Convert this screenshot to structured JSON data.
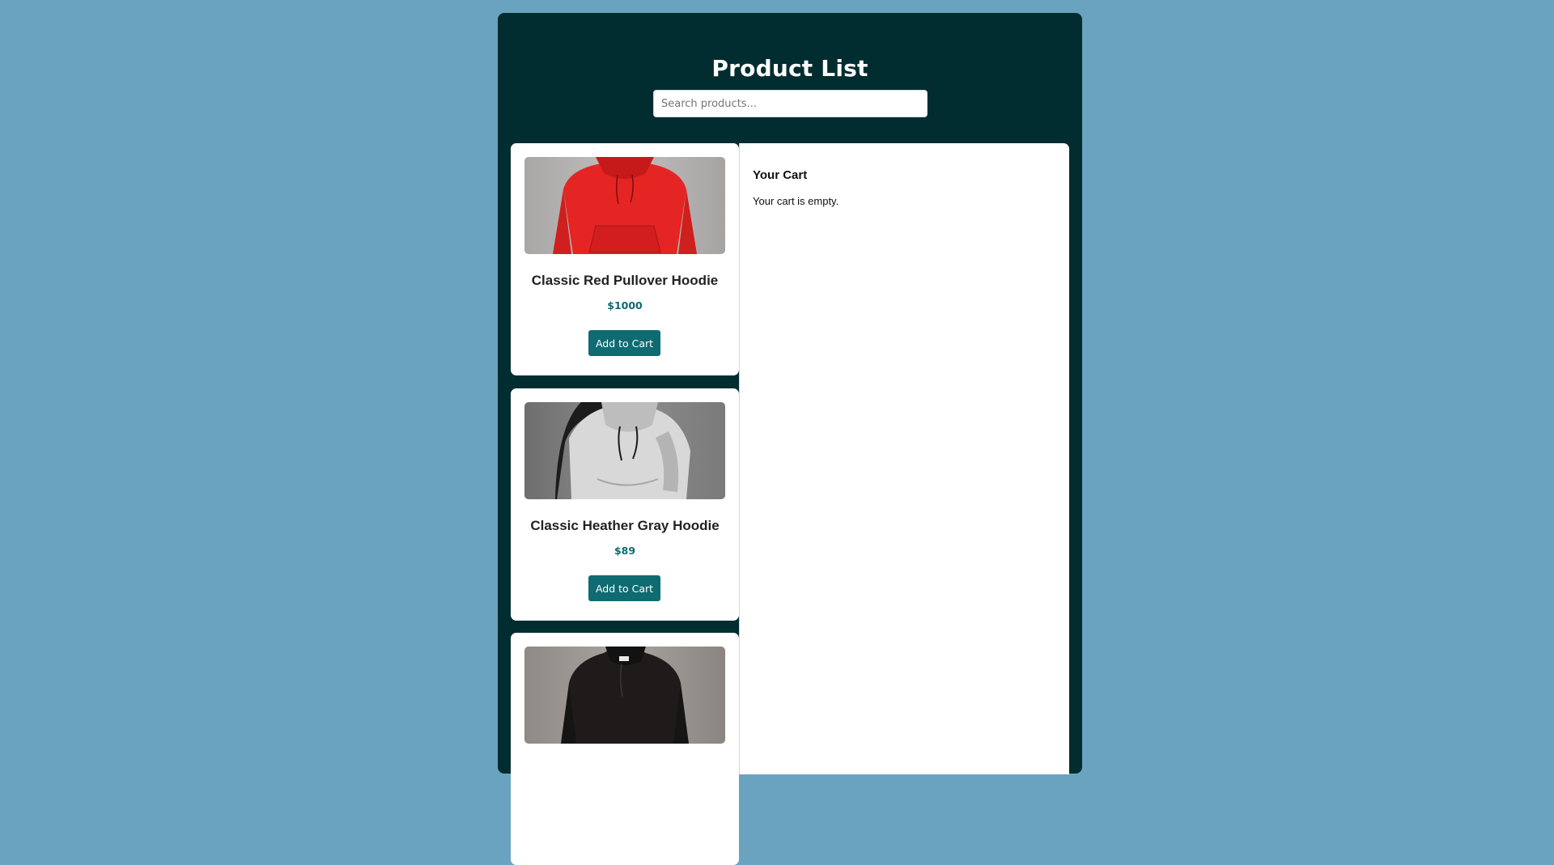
{
  "header": {
    "title": "Product List"
  },
  "search": {
    "placeholder": "Search products..."
  },
  "products": [
    {
      "name": "Classic Red Pullover Hoodie",
      "price": "$1000",
      "button_label": "Add to Cart",
      "image_icon": "red-hoodie-image"
    },
    {
      "name": "Classic Heather Gray Hoodie",
      "price": "$89",
      "button_label": "Add to Cart",
      "image_icon": "gray-hoodie-image"
    },
    {
      "name": "",
      "price": "",
      "button_label": "",
      "image_icon": "black-hoodie-image"
    }
  ],
  "cart": {
    "title": "Your Cart",
    "empty_message": "Your cart is empty."
  },
  "colors": {
    "page_background": "#6aa3bf",
    "app_background": "#022d30",
    "accent": "#0f6b72"
  }
}
